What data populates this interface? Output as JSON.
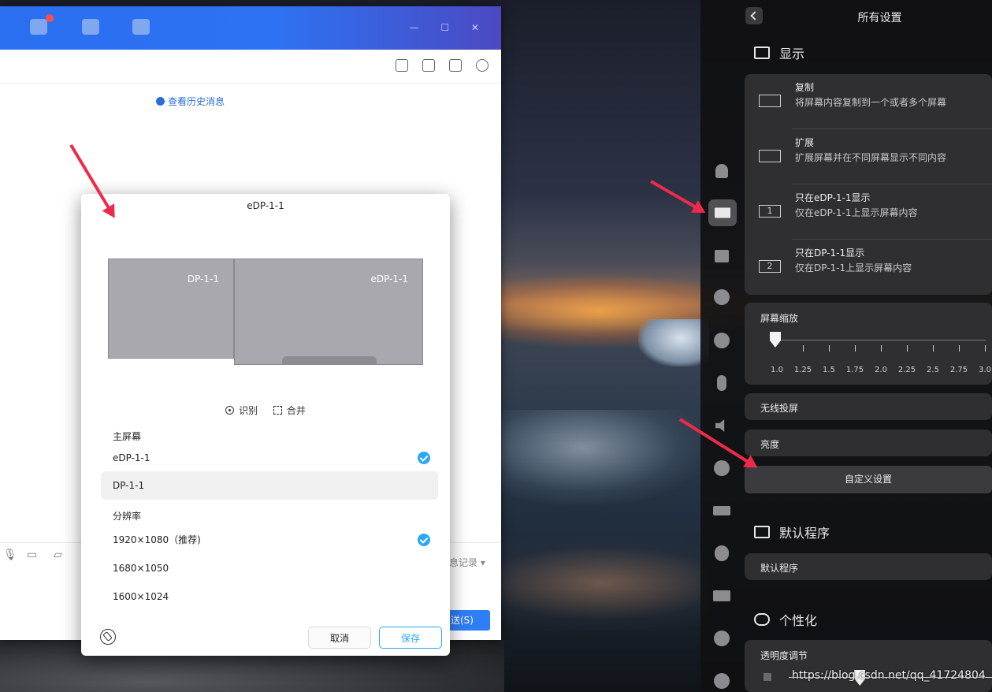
{
  "chat": {
    "history_link": "查看历史消息",
    "message_record": "息记录 ▾",
    "send_label": "送(S)"
  },
  "dialog": {
    "title": "eDP-1-1",
    "monitors": [
      {
        "name": "DP-1-1"
      },
      {
        "name": "eDP-1-1"
      }
    ],
    "actions": {
      "identify": "识别",
      "merge": "合并"
    },
    "primary_screen": {
      "label": "主屏幕",
      "options": [
        {
          "label": "eDP-1-1",
          "selected": true
        },
        {
          "label": "DP-1-1",
          "selected": false
        }
      ]
    },
    "resolution": {
      "label": "分辨率",
      "options": [
        {
          "label": "1920×1080（推荐)",
          "selected": true
        },
        {
          "label": "1680×1050",
          "selected": false
        },
        {
          "label": "1600×1024",
          "selected": false
        }
      ]
    },
    "cancel_label": "取消",
    "save_label": "保存"
  },
  "settings": {
    "title": "所有设置",
    "display_section": "显示",
    "modes": [
      {
        "title": "复制",
        "desc": "将屏幕内容复制到一个或者多个屏幕",
        "icon": "duplicate-screen-icon"
      },
      {
        "title": "扩展",
        "desc": "扩展屏幕并在不同屏幕显示不同内容",
        "icon": "extend-screen-icon"
      },
      {
        "title": "只在eDP-1-1显示",
        "desc": "仅在eDP-1-1上显示屏幕内容",
        "icon": "screen-1-icon",
        "num": "1"
      },
      {
        "title": "只在DP-1-1显示",
        "desc": "仅在DP-1-1上显示屏幕内容",
        "icon": "screen-2-icon",
        "num": "2"
      }
    ],
    "scale": {
      "title": "屏幕缩放",
      "values": [
        "1.0",
        "1.25",
        "1.5",
        "1.75",
        "2.0",
        "2.25",
        "2.5",
        "2.75",
        "3.0"
      ],
      "current": "1.0"
    },
    "wireless_cast": "无线投屏",
    "brightness": "亮度",
    "custom_settings": "自定义设置",
    "default_apps_section": "默认程序",
    "default_apps_row": "默认程序",
    "personalization_section": "个性化",
    "transparency": {
      "title": "透明度调节",
      "level_fraction": 0.35
    }
  },
  "watermark": "https://blog.csdn.net/qq_41724804",
  "colors": {
    "accent": "#2ca7f8",
    "arrow": "#ee2a4a",
    "chat_header": "#2d72f2"
  }
}
